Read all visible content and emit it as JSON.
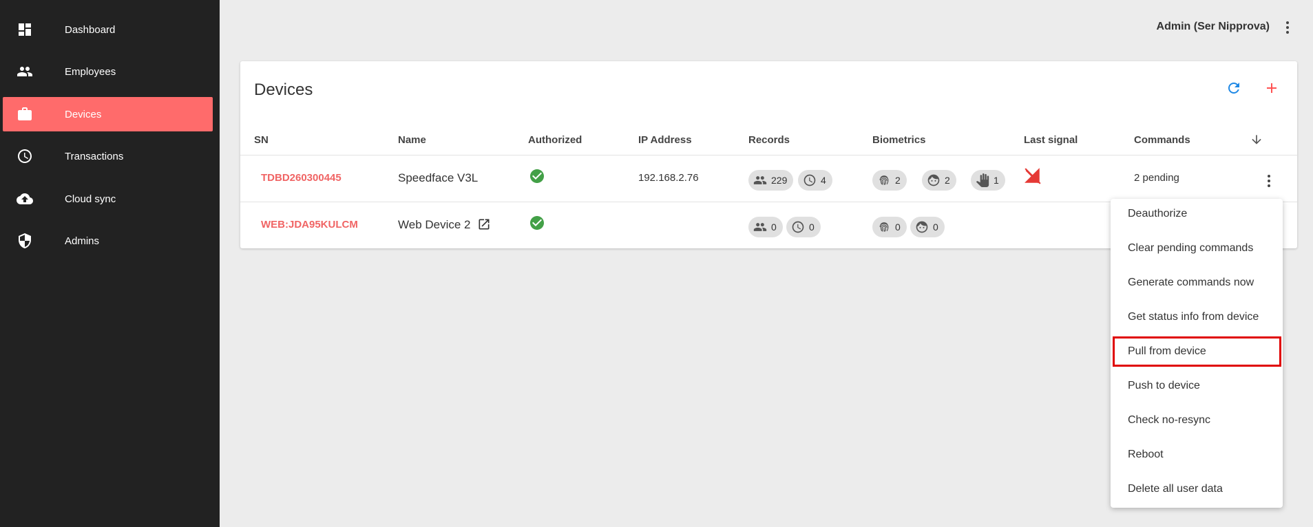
{
  "sidebar": {
    "items": [
      {
        "label": "Dashboard",
        "icon": "dashboard-icon"
      },
      {
        "label": "Employees",
        "icon": "people-icon"
      },
      {
        "label": "Devices",
        "icon": "briefcase-icon",
        "active": true
      },
      {
        "label": "Transactions",
        "icon": "clock-icon"
      },
      {
        "label": "Cloud sync",
        "icon": "cloud-upload-icon"
      },
      {
        "label": "Admins",
        "icon": "shield-icon"
      }
    ]
  },
  "header": {
    "user": "Admin (Ser Nipprova)"
  },
  "devices": {
    "title": "Devices",
    "columns": [
      "SN",
      "Name",
      "Authorized",
      "IP Address",
      "Records",
      "Biometrics",
      "Last signal",
      "Commands"
    ],
    "rows": [
      {
        "sn": "TDBD260300445",
        "name": "Speedface V3L",
        "ip": "192.168.2.76",
        "records": {
          "users": "229",
          "transactions": "4"
        },
        "biometrics": {
          "fingerprint": "2",
          "face": "2",
          "palm": "1"
        },
        "commands": "2 pending"
      },
      {
        "sn": "WEB:JDA95KULCM",
        "name": "Web Device 2",
        "ip": "",
        "records": {
          "users": "0",
          "transactions": "0"
        },
        "biometrics": {
          "fingerprint": "0",
          "face": "0"
        },
        "commands": ""
      }
    ]
  },
  "menu": {
    "items": [
      "Deauthorize",
      "Clear pending commands",
      "Generate commands now",
      "Get status info from device",
      "Pull from device",
      "Push to device",
      "Check no-resync",
      "Reboot",
      "Delete all user data"
    ],
    "highlighted_index": 4
  },
  "colors": {
    "sidebar_bg": "#222222",
    "accent": "#ff6b6b",
    "sn_text": "#f06464",
    "success": "#43a047",
    "refresh": "#1e88e5",
    "highlight_border": "#e00000"
  }
}
